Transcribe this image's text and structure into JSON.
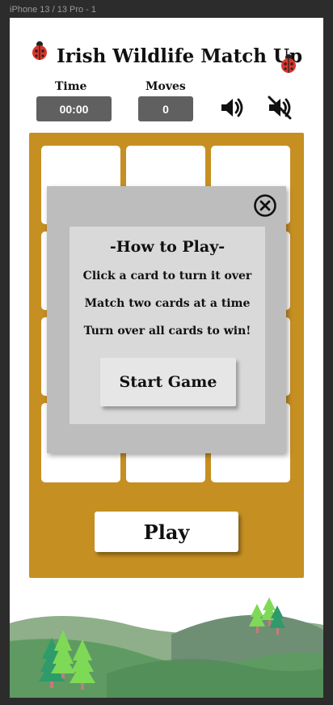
{
  "frame": {
    "label": "iPhone 13 / 13 Pro - 1"
  },
  "header": {
    "title": "Irish Wildlife Match Up"
  },
  "stats": {
    "time_label": "Time",
    "time_value": "00:00",
    "moves_label": "Moves",
    "moves_value": "0"
  },
  "sound": {
    "on_icon": "speaker-on-icon",
    "off_icon": "speaker-muted-icon"
  },
  "board": {
    "cards": 12,
    "play_label": "Play"
  },
  "modal": {
    "title": "-How to Play-",
    "lines": [
      "Click a card to turn it over",
      "Match two cards at a time",
      "Turn over all cards to win!"
    ],
    "start_label": "Start Game"
  },
  "colors": {
    "board": "#c68f22",
    "stat_box": "#606060",
    "modal_outer": "#bdbdbd",
    "modal_inner": "#d9d9d9",
    "hills": "#5f9a63"
  }
}
